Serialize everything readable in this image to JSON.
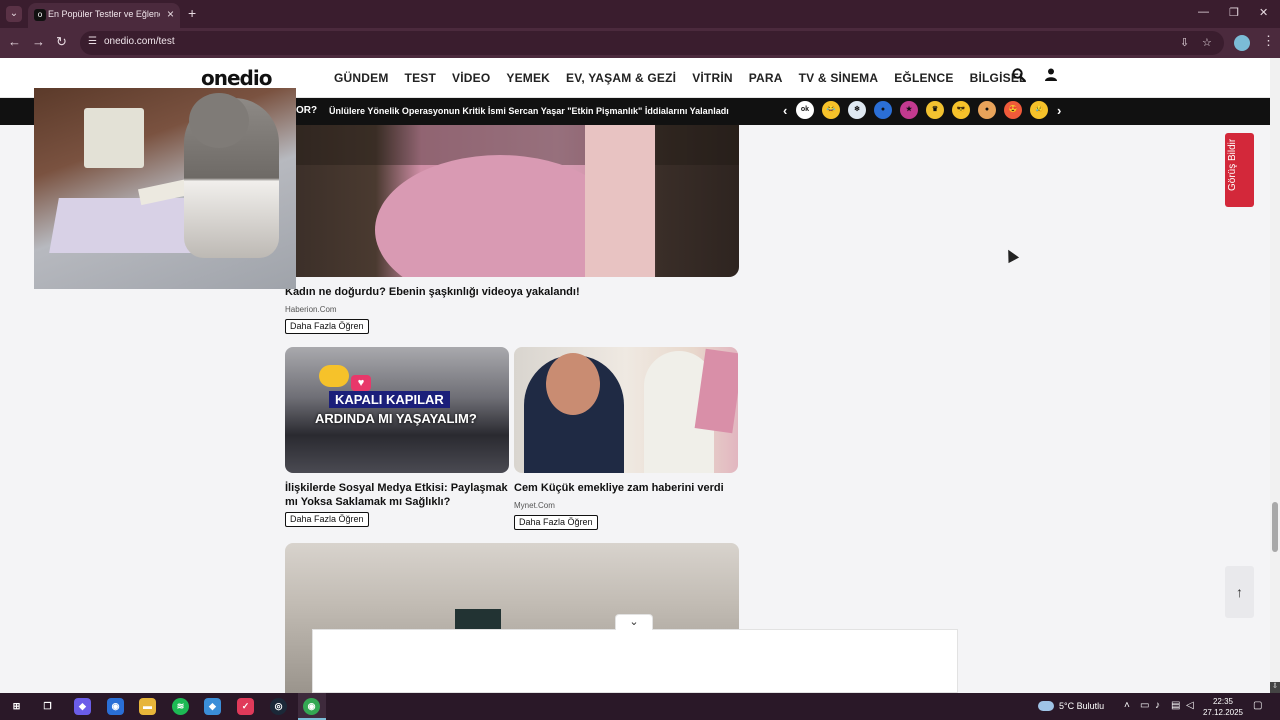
{
  "browser": {
    "tab_title": "En Popüler Testler ve Eğlenceli Testler",
    "tab_favicon": "o",
    "url": "onedio.com/test",
    "controls": {
      "minimize": "—",
      "restore": "❐",
      "close": "✕",
      "back": "←",
      "forward": "→",
      "reload": "↻",
      "new_tab": "+",
      "tab_close": "×",
      "tab_dropdown": "⌄",
      "install": "⇩",
      "bookmark": "☆",
      "menu": "⋮"
    }
  },
  "site": {
    "logo": "onedio",
    "nav": [
      "GÜNDEM",
      "TEST",
      "VİDEO",
      "YEMEK",
      "EV, YAŞAM & GEZİ",
      "VİTRİN",
      "PARA",
      "TV & SİNEMA",
      "EĞLENCE",
      "BİLGİSEL"
    ],
    "ticker_cut": "OR?",
    "ticker_text": "Ünlülere Yönelik Operasyonun Kritik İsmi Sercan Yaşar \"Etkin Pişmanlık\" İddialarını Yalanladı",
    "ticker_prev": "‹",
    "ticker_next": "›",
    "reactions": [
      {
        "label": "ok",
        "color": "#ffffff"
      },
      {
        "label": "😂",
        "color": "#f6c22a"
      },
      {
        "label": "❄",
        "color": "#dfe9f2"
      },
      {
        "label": "●",
        "color": "#2b6fd6"
      },
      {
        "label": "★",
        "color": "#c33a8f"
      },
      {
        "label": "♛",
        "color": "#f2c230"
      },
      {
        "label": "😎",
        "color": "#f6c22a"
      },
      {
        "label": "●",
        "color": "#e8a35a"
      },
      {
        "label": "😍",
        "color": "#f05a3a"
      },
      {
        "label": "😢",
        "color": "#f6c22a"
      }
    ]
  },
  "content": {
    "article1": {
      "caption": "Kadın ne doğurdu? Ebenin şaşkınlığı videoya yakalandı!",
      "source": "Haberion.Com",
      "button": "Daha Fazla Öğren"
    },
    "card1": {
      "img_label1": "KAPALI KAPILAR",
      "img_label2": "ARDINDA MI YAŞAYALIM?",
      "caption": "İlişkilerde Sosyal Medya Etkisi: Paylaşmak mı Yoksa Saklamak mı Sağlıklı?",
      "button": "Daha Fazla Öğren"
    },
    "card2": {
      "caption": "Cem Küçük emekliye zam haberini verdi",
      "source": "Mynet.Com",
      "button": "Daha Fazla Öğren"
    }
  },
  "widgets": {
    "feedback": "Görüş Bildir",
    "scroll_top": "↑",
    "ad_collapse": "⌄"
  },
  "taskbar": {
    "weather": "5°C  Bulutlu",
    "time": "22:35",
    "date": "27.12.2025",
    "icons": [
      {
        "name": "windows-start-icon",
        "glyph": "⊞",
        "color": "#2a1828"
      },
      {
        "name": "task-view-icon",
        "glyph": "❐",
        "color": "#2a1828"
      },
      {
        "name": "copilot-icon",
        "glyph": "◆",
        "color": "#6b5de8"
      },
      {
        "name": "edge-icon",
        "glyph": "◉",
        "color": "#2a6fd6"
      },
      {
        "name": "file-explorer-icon",
        "glyph": "▬",
        "color": "#e7b53a"
      },
      {
        "name": "spotify-icon",
        "glyph": "≋",
        "color": "#1db954"
      },
      {
        "name": "app-icon",
        "glyph": "◆",
        "color": "#3b8ed8"
      },
      {
        "name": "pocket-icon",
        "glyph": "✓",
        "color": "#e03a5a"
      },
      {
        "name": "steam-icon",
        "glyph": "◎",
        "color": "#1b2838"
      },
      {
        "name": "chrome-icon",
        "glyph": "◉",
        "color": "#34a853"
      }
    ]
  }
}
